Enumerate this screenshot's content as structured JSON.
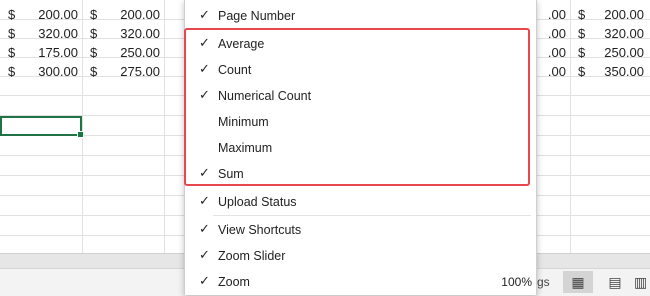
{
  "sheet": {
    "left_rows": [
      {
        "dollar_a": "$",
        "val_a": "200.00",
        "dollar_b": "$",
        "val_b": "200.00"
      },
      {
        "dollar_a": "$",
        "val_a": "320.00",
        "dollar_b": "$",
        "val_b": "320.00"
      },
      {
        "dollar_a": "$",
        "val_a": "175.00",
        "dollar_b": "$",
        "val_b": "250.00"
      },
      {
        "dollar_a": "$",
        "val_a": "300.00",
        "dollar_b": "$",
        "val_b": "275.00"
      }
    ],
    "right_rows": [
      {
        "partial": ".00",
        "dollar": "$",
        "val": "200.00"
      },
      {
        "partial": ".00",
        "dollar": "$",
        "val": "320.00"
      },
      {
        "partial": ".00",
        "dollar": "$",
        "val": "250.00"
      },
      {
        "partial": ".00",
        "dollar": "$",
        "val": "350.00"
      }
    ]
  },
  "menu": {
    "items": [
      {
        "label": "Page Number",
        "checked": "✓"
      },
      {
        "label": "Average",
        "checked": "✓"
      },
      {
        "label": "Count",
        "checked": "✓"
      },
      {
        "label": "Numerical Count",
        "checked": "✓"
      },
      {
        "label": "Minimum",
        "checked": ""
      },
      {
        "label": "Maximum",
        "checked": ""
      },
      {
        "label": "Sum",
        "checked": "✓"
      },
      {
        "label": "Upload Status",
        "checked": "✓"
      },
      {
        "label": "View Shortcuts",
        "checked": "✓"
      },
      {
        "label": "Zoom Slider",
        "checked": "✓"
      },
      {
        "label": "Zoom",
        "checked": "✓",
        "value": "100%"
      }
    ]
  },
  "statusbar": {
    "partial_text": "gs",
    "views": [
      {
        "icon": "normal-view-icon",
        "glyph": "▦"
      },
      {
        "icon": "page-layout-view-icon",
        "glyph": "▤"
      },
      {
        "icon": "page-break-view-icon",
        "glyph": "▥"
      }
    ]
  },
  "colors": {
    "highlight": "#e8484d",
    "active_cell": "#217346"
  }
}
